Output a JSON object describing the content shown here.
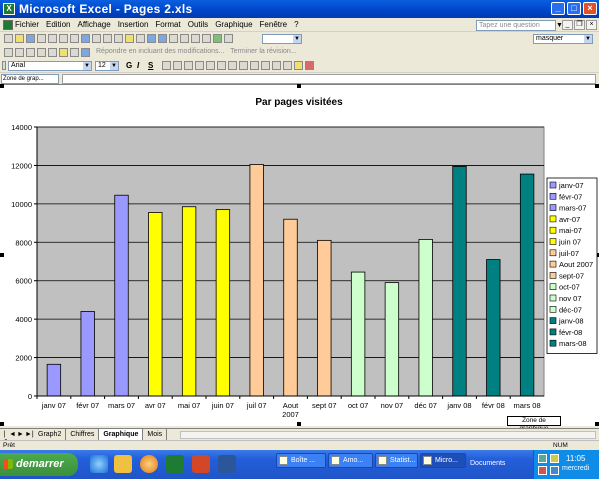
{
  "window": {
    "title": "Microsoft Excel - Pages 2.xls",
    "help_placeholder": "Tapez une question"
  },
  "menu": {
    "items": [
      "Fichier",
      "Edition",
      "Affichage",
      "Insertion",
      "Format",
      "Outils",
      "Graphique",
      "Fenêtre",
      "?"
    ]
  },
  "toolbar": {
    "reply_text": "Répondre en incluant des modifications...",
    "end_review_text": "Terminer la révision...",
    "masquer_label": "masquer",
    "font_name": "Arial",
    "font_size": "12",
    "bold": "G",
    "italic": "I",
    "underline": "S"
  },
  "namebox": {
    "value": "Zone de grap..."
  },
  "sheet_tabs": {
    "tabs": [
      "Graph2",
      "Chiffres",
      "Graphique",
      "Mois"
    ],
    "active": "Graphique"
  },
  "statusbar": {
    "left": "Prêt",
    "num": "NUM"
  },
  "chart_label_box": "Zone de graphique",
  "taskbar": {
    "start": "demarrer",
    "tasks": [
      "Boîte ...",
      "Amo...",
      "Statist...",
      "Micro..."
    ],
    "documents": "Documents",
    "clock": "11:05",
    "day": "mercredi"
  },
  "chart_data": {
    "type": "bar",
    "title": "Par pages visitées",
    "categories": [
      "janv 07",
      "févr 07",
      "mars 07",
      "avr 07",
      "mai 07",
      "juin 07",
      "juil 07",
      "Aout 2007",
      "sept 07",
      "oct 07",
      "nov 07",
      "déc 07",
      "janv 08",
      "févr 08",
      "mars 08"
    ],
    "values": [
      1650,
      4400,
      10450,
      9550,
      9850,
      9700,
      12050,
      9200,
      8100,
      6450,
      5900,
      8150,
      11950,
      7100,
      11550
    ],
    "colors": [
      "#9999ff",
      "#9999ff",
      "#9999ff",
      "#ffff00",
      "#ffff00",
      "#ffff00",
      "#ffcc99",
      "#ffcc99",
      "#ffcc99",
      "#ccffcc",
      "#ccffcc",
      "#ccffcc",
      "#008080",
      "#008080",
      "#008080"
    ],
    "legend": [
      "janv-07",
      "févr-07",
      "mars-07",
      "avr-07",
      "mai-07",
      "juin 07",
      "juil-07",
      "Aout 2007",
      "sept-07",
      "oct-07",
      "nov 07",
      "déc-07",
      "janv-08",
      "févr-08",
      "mars-08"
    ],
    "legend_position": "right",
    "ylim": [
      0,
      14000
    ],
    "yticks": [
      0,
      2000,
      4000,
      6000,
      8000,
      10000,
      12000,
      14000
    ],
    "grid": true,
    "plot_background": "#c0c0c0"
  }
}
